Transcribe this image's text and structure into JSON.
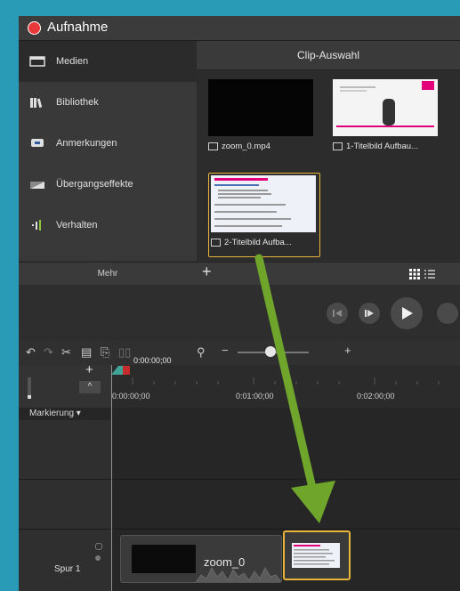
{
  "window": {
    "title": "Aufnahme"
  },
  "sidebar": {
    "items": [
      {
        "label": "Medien",
        "icon": "film-icon",
        "active": true
      },
      {
        "label": "Bibliothek",
        "icon": "library-icon"
      },
      {
        "label": "Anmerkungen",
        "icon": "annotation-icon"
      },
      {
        "label": "Übergangseffekte",
        "icon": "transition-icon"
      },
      {
        "label": "Verhalten",
        "icon": "behavior-icon"
      }
    ],
    "more_label": "Mehr"
  },
  "clip_bin": {
    "header": "Clip-Auswahl",
    "clips": [
      {
        "label": "zoom_0.mp4",
        "kind": "video"
      },
      {
        "label": "1-Titelbild Aufbau...",
        "kind": "image"
      },
      {
        "label": "2-Titelbild Aufba...",
        "kind": "image",
        "selected": true
      }
    ],
    "add_label": "+"
  },
  "timeline": {
    "playhead_time": "0:00:00;00",
    "ruler_labels": [
      "0:00:00;00",
      "0:01:00;00",
      "0:02:00;00"
    ],
    "marker_label": "Markierung",
    "track_label": "Spur 1",
    "clip_label": "zoom_0"
  },
  "colors": {
    "accent": "#e9b43a",
    "record": "#e8383b",
    "arrow": "#6fa52b",
    "background": "#2a9bb6"
  }
}
